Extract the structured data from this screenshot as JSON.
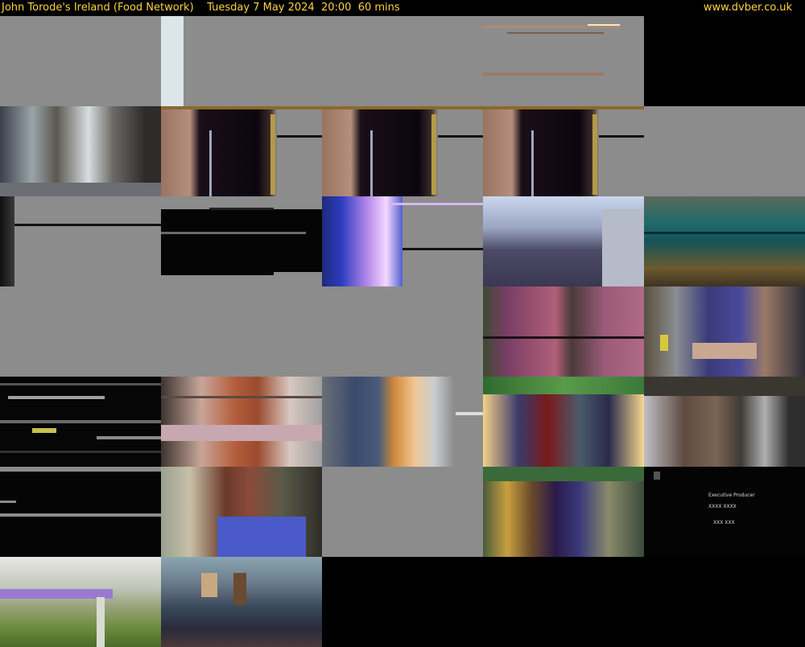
{
  "header": {
    "programme": "John Torode's Ireland (Food Network)",
    "schedule": "Tuesday 7 May 2024  20:00  60 mins",
    "site": "www.dvber.co.uk"
  },
  "colors": {
    "header_text": "#ffd23f",
    "background": "#000000",
    "placeholder_grey": "#8c8c8c"
  },
  "thumbnails": [
    {
      "row": 0,
      "col": 0,
      "style": "grey"
    },
    {
      "row": 0,
      "col": 1,
      "style": "grey-left-white"
    },
    {
      "row": 0,
      "col": 2,
      "style": "grey"
    },
    {
      "row": 0,
      "col": 3,
      "style": "grey-streaks"
    },
    {
      "row": 1,
      "col": 0,
      "style": "street"
    },
    {
      "row": 1,
      "col": 1,
      "style": "dark-doorway"
    },
    {
      "row": 1,
      "col": 2,
      "style": "dark-doorway"
    },
    {
      "row": 1,
      "col": 3,
      "style": "dark-doorway"
    },
    {
      "row": 1,
      "col": 4,
      "style": "grey"
    },
    {
      "row": 2,
      "col": 0,
      "style": "grey-left-black"
    },
    {
      "row": 2,
      "col": 1,
      "style": "black-block"
    },
    {
      "row": 2,
      "col": 2,
      "style": "purple-light"
    },
    {
      "row": 2,
      "col": 3,
      "style": "city"
    },
    {
      "row": 2,
      "col": 4,
      "style": "teal"
    },
    {
      "row": 3,
      "col": 0,
      "style": "grey"
    },
    {
      "row": 3,
      "col": 1,
      "style": "grey"
    },
    {
      "row": 3,
      "col": 2,
      "style": "grey"
    },
    {
      "row": 3,
      "col": 3,
      "style": "magenta"
    },
    {
      "row": 3,
      "col": 4,
      "style": "blue-shop"
    },
    {
      "row": 4,
      "col": 0,
      "style": "black-noise"
    },
    {
      "row": 4,
      "col": 1,
      "style": "kitchen"
    },
    {
      "row": 4,
      "col": 2,
      "style": "orange-blue"
    },
    {
      "row": 4,
      "col": 3,
      "style": "sunset"
    },
    {
      "row": 4,
      "col": 4,
      "style": "brown-grey"
    },
    {
      "row": 5,
      "col": 0,
      "style": "black-bottom"
    },
    {
      "row": 5,
      "col": 1,
      "style": "brown-blue"
    },
    {
      "row": 5,
      "col": 2,
      "style": "grey"
    },
    {
      "row": 5,
      "col": 3,
      "style": "market"
    },
    {
      "row": 5,
      "col": 4,
      "style": "credits"
    },
    {
      "row": 6,
      "col": 0,
      "style": "field"
    },
    {
      "row": 6,
      "col": 1,
      "style": "crowd"
    }
  ],
  "credits_text": [
    "Executive Producer",
    "XXXX XXXX",
    "XXX XXX"
  ]
}
